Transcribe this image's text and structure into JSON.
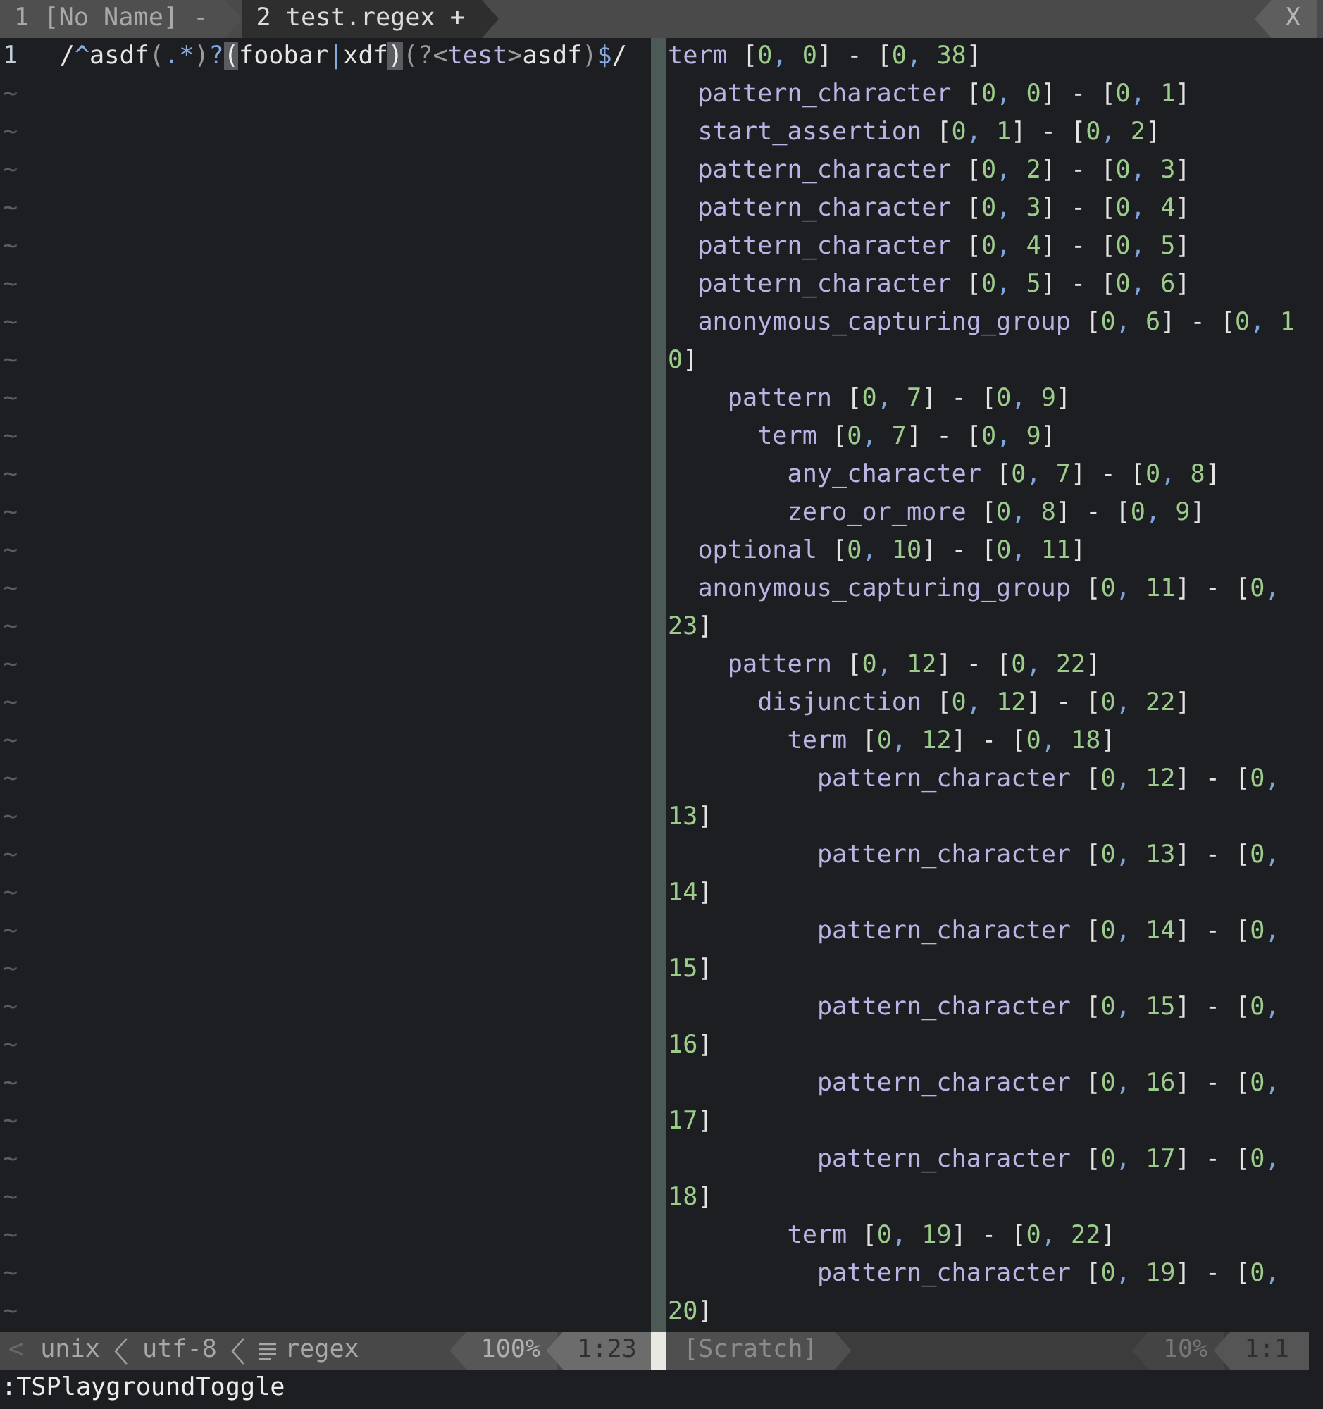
{
  "tabline": {
    "tabs": [
      {
        "label": "1 [No Name] -",
        "selected": false
      },
      {
        "label": "2 test.regex +",
        "selected": true
      }
    ],
    "close": "X"
  },
  "editor": {
    "line_number": "1",
    "tokens": [
      {
        "text": "/",
        "kind": "plain"
      },
      {
        "text": "^",
        "kind": "special"
      },
      {
        "text": "asdf",
        "kind": "plain"
      },
      {
        "text": "(",
        "kind": "punct"
      },
      {
        "text": ".*",
        "kind": "special"
      },
      {
        "text": ")",
        "kind": "punct"
      },
      {
        "text": "?",
        "kind": "special"
      },
      {
        "text": "(",
        "kind": "match"
      },
      {
        "text": "foobar",
        "kind": "plain"
      },
      {
        "text": "|",
        "kind": "special"
      },
      {
        "text": "xdf",
        "kind": "plain"
      },
      {
        "text": ")",
        "kind": "match"
      },
      {
        "text": "(?<",
        "kind": "punct"
      },
      {
        "text": "test",
        "kind": "name"
      },
      {
        "text": ">",
        "kind": "punct"
      },
      {
        "text": "asdf",
        "kind": "plain"
      },
      {
        "text": ")",
        "kind": "punct"
      },
      {
        "text": "$",
        "kind": "special"
      },
      {
        "text": "/",
        "kind": "plain"
      }
    ],
    "filler": [
      "~",
      "~",
      "~",
      "~",
      "~",
      "~",
      "~",
      "~",
      "~",
      "~",
      "~",
      "~",
      "~",
      "~",
      "~",
      "~",
      "~",
      "~",
      "~",
      "~",
      "~",
      "~",
      "~",
      "~",
      "~",
      "~",
      "~",
      "~",
      "~",
      "~",
      "~",
      "~",
      "~"
    ]
  },
  "playground": {
    "tree": [
      {
        "name": "term",
        "range": "[0, 0] - [0, 38]",
        "children": [
          {
            "name": "pattern_character",
            "range": "[0, 0] - [0, 1]"
          },
          {
            "name": "start_assertion",
            "range": "[0, 1] - [0, 2]"
          },
          {
            "name": "pattern_character",
            "range": "[0, 2] - [0, 3]"
          },
          {
            "name": "pattern_character",
            "range": "[0, 3] - [0, 4]"
          },
          {
            "name": "pattern_character",
            "range": "[0, 4] - [0, 5]"
          },
          {
            "name": "pattern_character",
            "range": "[0, 5] - [0, 6]"
          },
          {
            "name": "anonymous_capturing_group",
            "range": "[0, 6] - [0, 1",
            "wrap": "0]",
            "children": [
              {
                "name": "pattern",
                "range": "[0, 7] - [0, 9]",
                "children": [
                  {
                    "name": "term",
                    "range": "[0, 7] - [0, 9]",
                    "children": [
                      {
                        "name": "any_character",
                        "range": "[0, 7] - [0, 8]"
                      },
                      {
                        "name": "zero_or_more",
                        "range": "[0, 8] - [0, 9]"
                      }
                    ]
                  }
                ]
              }
            ]
          },
          {
            "name": "optional",
            "range": "[0, 10] - [0, 11]"
          },
          {
            "name": "anonymous_capturing_group",
            "range": "[0, 11] - [0,",
            "wrap": "23]",
            "children": [
              {
                "name": "pattern",
                "range": "[0, 12] - [0, 22]",
                "children": [
                  {
                    "name": "disjunction",
                    "range": "[0, 12] - [0, 22]",
                    "children": [
                      {
                        "name": "term",
                        "range": "[0, 12] - [0, 18]",
                        "children": [
                          {
                            "name": "pattern_character",
                            "range": "[0, 12] - [0,",
                            "wrap": "13]"
                          },
                          {
                            "name": "pattern_character",
                            "range": "[0, 13] - [0,",
                            "wrap": "14]"
                          },
                          {
                            "name": "pattern_character",
                            "range": "[0, 14] - [0,",
                            "wrap": "15]"
                          },
                          {
                            "name": "pattern_character",
                            "range": "[0, 15] - [0,",
                            "wrap": "16]"
                          },
                          {
                            "name": "pattern_character",
                            "range": "[0, 16] - [0,",
                            "wrap": "17]"
                          },
                          {
                            "name": "pattern_character",
                            "range": "[0, 17] - [0,",
                            "wrap": "18]"
                          }
                        ]
                      },
                      {
                        "name": "term",
                        "range": "[0, 19] - [0, 22]",
                        "children": [
                          {
                            "name": "pattern_character",
                            "range": "[0, 19] - [0,",
                            "wrap": "20]"
                          }
                        ]
                      }
                    ]
                  }
                ]
              }
            ]
          }
        ]
      }
    ]
  },
  "left_status": {
    "lead": "<",
    "fileformat": "unix",
    "encoding": "utf-8",
    "filetype": "regex",
    "percent": "100%",
    "position": "1:23"
  },
  "right_status": {
    "name": "[Scratch]",
    "percent": "10%",
    "position": "1:1"
  },
  "command_line": ":TSPlaygroundToggle"
}
